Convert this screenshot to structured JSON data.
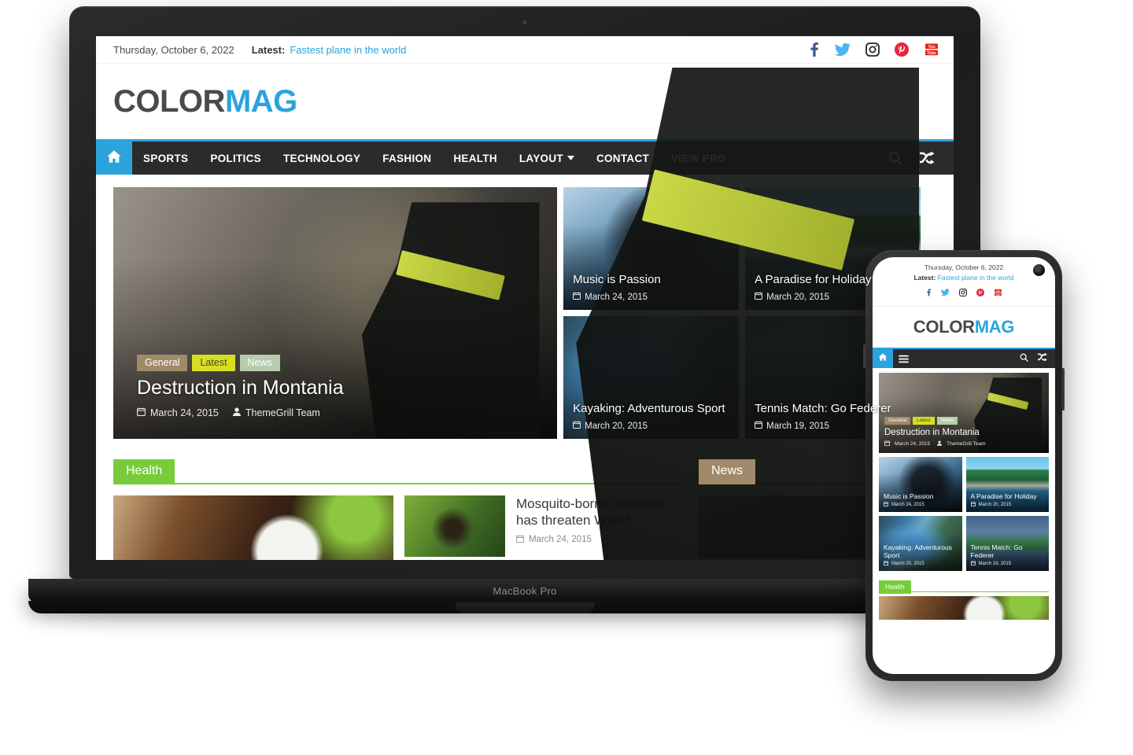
{
  "device": {
    "laptop_label": "MacBook Pro"
  },
  "colors": {
    "accent_blue": "#2ba3dd",
    "logo_dark": "#4a4a4a",
    "nav_bg": "#2b2b2b",
    "tag_general": "#a08a6a",
    "tag_latest": "#d7df23",
    "tag_news": "#b6ccac",
    "health_green": "#78cc3a",
    "news_brown": "#a08a6a",
    "facebook": "#3b5998",
    "twitter": "#4ab3f4",
    "instagram": "#262626",
    "pinterest": "#e8253a",
    "youtube": "#e62117"
  },
  "topbar": {
    "date": "Thursday, October 6, 2022",
    "latest_label": "Latest:",
    "latest_link": "Fastest plane in the world",
    "social": [
      {
        "name": "facebook-icon",
        "label": "Facebook"
      },
      {
        "name": "twitter-icon",
        "label": "Twitter"
      },
      {
        "name": "instagram-icon",
        "label": "Instagram"
      },
      {
        "name": "pinterest-icon",
        "label": "Pinterest"
      },
      {
        "name": "youtube-icon",
        "label": "YouTube"
      }
    ]
  },
  "brand": {
    "logo_part1": "COLOR",
    "logo_part2": "MAG"
  },
  "nav": {
    "home_icon": "home-icon",
    "items": [
      {
        "label": "SPORTS",
        "has_dropdown": false
      },
      {
        "label": "POLITICS",
        "has_dropdown": false
      },
      {
        "label": "TECHNOLOGY",
        "has_dropdown": false
      },
      {
        "label": "FASHION",
        "has_dropdown": false
      },
      {
        "label": "HEALTH",
        "has_dropdown": false
      },
      {
        "label": "LAYOUT",
        "has_dropdown": true
      },
      {
        "label": "CONTACT",
        "has_dropdown": false
      },
      {
        "label": "VIEW PRO",
        "has_dropdown": false
      }
    ],
    "chevron": "⌄",
    "search_icon": "search-icon",
    "random_icon": "shuffle-icon"
  },
  "hero": {
    "featured": {
      "title": "Destruction in Montania",
      "tags": [
        "General",
        "Latest",
        "News"
      ],
      "date": "March 24, 2015",
      "author": "ThemeGrill Team",
      "image": "firefighter-pointing"
    },
    "cards": [
      {
        "title": "Music is Passion",
        "date": "March 24, 2015",
        "image": "violinist"
      },
      {
        "title": "A Paradise for Holiday",
        "date": "March 20, 2015",
        "image": "tropical-beach"
      },
      {
        "title": "Kayaking: Adventurous Sport",
        "date": "March 20, 2015",
        "image": "kayaker-in-river"
      },
      {
        "title": "Tennis Match: Go Federer",
        "date": "March 19, 2015",
        "image": "tennis-stadium"
      }
    ]
  },
  "sections": {
    "health": {
      "title": "Health",
      "items": [
        {
          "title": "",
          "image": "coffee-beans",
          "date": ""
        },
        {
          "title": "Mosquito-borne diseases has threaten World",
          "image": "mosquito",
          "date": "March 24, 2015"
        }
      ]
    },
    "news": {
      "title": "News",
      "items": [
        {
          "title": "",
          "image": "firefighter-pointing",
          "date": ""
        }
      ]
    }
  },
  "mobile": {
    "topbar": {
      "date": "Thursday, October 6, 2022",
      "latest_label": "Latest:",
      "latest_link": "Fastest plane in the world"
    },
    "brand": {
      "logo_part1": "COLOR",
      "logo_part2": "MAG"
    },
    "nav": {
      "home_icon": "home-icon",
      "menu_icon": "hamburger-menu-icon",
      "search_icon": "search-icon",
      "random_icon": "shuffle-icon"
    },
    "hero": {
      "title": "Destruction in Montania",
      "tags": [
        "General",
        "Latest",
        "News"
      ],
      "date": "March 24, 2015",
      "author": "ThemeGrill Team"
    },
    "cards": [
      {
        "title": "Music is Passion",
        "date": "March 24, 2015"
      },
      {
        "title": "A Paradise for Holiday",
        "date": "March 20, 2015"
      },
      {
        "title": "Kayaking: Adventurous Sport",
        "date": "March 20, 2015"
      },
      {
        "title": "Tennis Match: Go Federer",
        "date": "March 19, 2015"
      }
    ],
    "section_health_title": "Health"
  }
}
